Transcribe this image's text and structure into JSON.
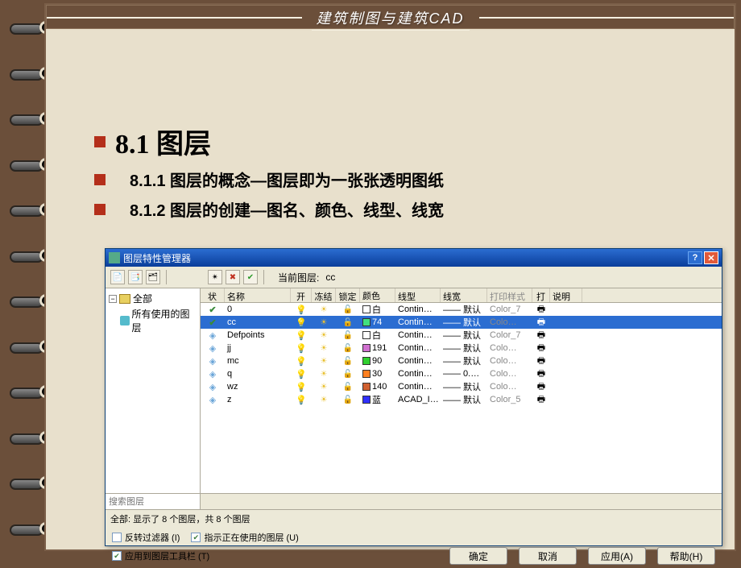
{
  "slide": {
    "header_title": "建筑制图与建筑CAD",
    "heading": "8.1 图层",
    "sub1": "8.1.1  图层的概念—图层即为一张张透明图纸",
    "sub2": "8.1.2  图层的创建—图名、颜色、线型、线宽"
  },
  "dialog": {
    "title": "图层特性管理器",
    "current_layer_label": "当前图层:",
    "current_layer": "cc",
    "tree": {
      "root": "全部",
      "child": "所有使用的图层"
    },
    "columns": {
      "state": "状",
      "name": "名称",
      "on": "开",
      "freeze": "冻结",
      "lock": "锁定",
      "color": "颜色",
      "linetype": "线型",
      "lineweight": "线宽",
      "plotstyle": "打印样式",
      "plot": "打",
      "desc": "说明"
    },
    "rows": [
      {
        "state": "✓",
        "name": "0",
        "color_swatch": "#ffffff",
        "color": "白",
        "linetype": "Contin…",
        "lineweight": "—— 默认",
        "plotstyle": "Color_7",
        "selected": false
      },
      {
        "state": "✓",
        "name": "cc",
        "color_swatch": "#40e080",
        "color": "74",
        "linetype": "Contin…",
        "lineweight": "—— 默认",
        "plotstyle": "Colo…",
        "selected": true
      },
      {
        "state": "",
        "name": "Defpoints",
        "color_swatch": "#ffffff",
        "color": "白",
        "linetype": "Contin…",
        "lineweight": "—— 默认",
        "plotstyle": "Color_7",
        "selected": false
      },
      {
        "state": "",
        "name": "jj",
        "color_swatch": "#d070d0",
        "color": "191",
        "linetype": "Contin…",
        "lineweight": "—— 默认",
        "plotstyle": "Colo…",
        "selected": false
      },
      {
        "state": "",
        "name": "mc",
        "color_swatch": "#30d030",
        "color": "90",
        "linetype": "Contin…",
        "lineweight": "—— 默认",
        "plotstyle": "Colo…",
        "selected": false
      },
      {
        "state": "",
        "name": "q",
        "color_swatch": "#ff8020",
        "color": "30",
        "linetype": "Contin…",
        "lineweight": "—— 0.…",
        "plotstyle": "Colo…",
        "selected": false
      },
      {
        "state": "",
        "name": "wz",
        "color_swatch": "#d06030",
        "color": "140",
        "linetype": "Contin…",
        "lineweight": "—— 默认",
        "plotstyle": "Colo…",
        "selected": false
      },
      {
        "state": "",
        "name": "z",
        "color_swatch": "#3030ff",
        "color": "蓝",
        "linetype": "ACAD_I…",
        "lineweight": "—— 默认",
        "plotstyle": "Color_5",
        "selected": false
      }
    ],
    "search_placeholder": "搜索图层",
    "status": "全部: 显示了 8 个图层，共 8 个图层",
    "cb_invert": "反转过滤器 (I)",
    "cb_inuse": "指示正在使用的图层 (U)",
    "cb_toolbar": "应用到图层工具栏 (T)",
    "btn_ok": "确定",
    "btn_cancel": "取消",
    "btn_apply": "应用(A)",
    "btn_help": "帮助(H)"
  }
}
